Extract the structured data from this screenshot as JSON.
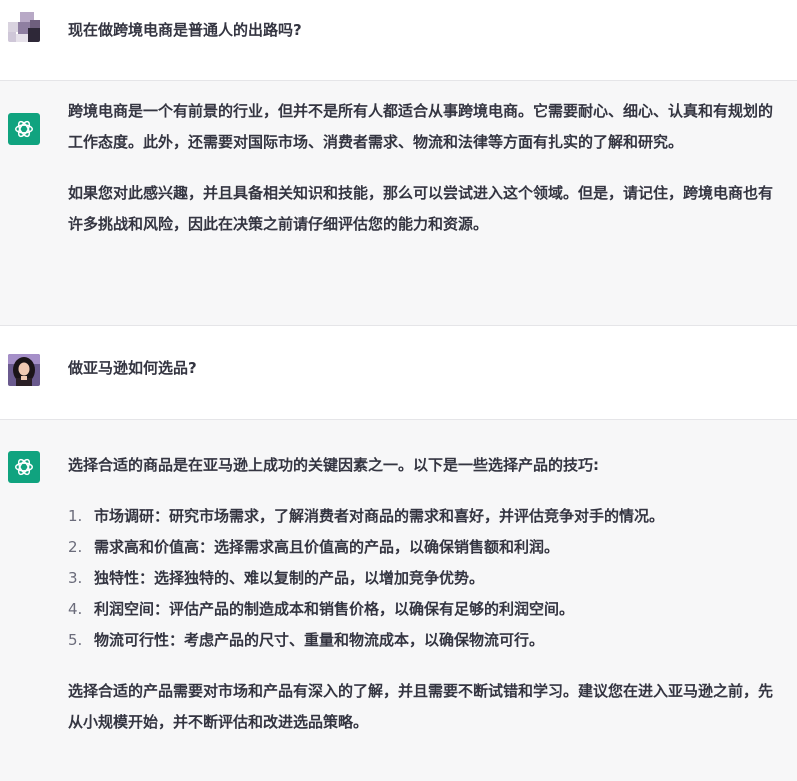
{
  "conversation": {
    "q1": "现在做跨境电商是普通人的出路吗?",
    "a1_p1": "跨境电商是一个有前景的行业，但并不是所有人都适合从事跨境电商。它需要耐心、细心、认真和有规划的工作态度。此外，还需要对国际市场、消费者需求、物流和法律等方面有扎实的了解和研究。",
    "a1_p2": "如果您对此感兴趣，并且具备相关知识和技能，那么可以尝试进入这个领域。但是，请记住，跨境电商也有许多挑战和风险，因此在决策之前请仔细评估您的能力和资源。",
    "q2": "做亚马逊如何选品?",
    "a2_intro": "选择合适的商品是在亚马逊上成功的关键因素之一。以下是一些选择产品的技巧:",
    "a2_list": [
      {
        "num": "1.",
        "text": "市场调研：研究市场需求，了解消费者对商品的需求和喜好，并评估竞争对手的情况。"
      },
      {
        "num": "2.",
        "text": "需求高和价值高：选择需求高且价值高的产品，以确保销售额和利润。"
      },
      {
        "num": "3.",
        "text": "独特性：选择独特的、难以复制的产品，以增加竞争优势。"
      },
      {
        "num": "4.",
        "text": "利润空间：评估产品的制造成本和销售价格，以确保有足够的利润空间。"
      },
      {
        "num": "5.",
        "text": "物流可行性：考虑产品的尺寸、重量和物流成本，以确保物流可行。"
      }
    ],
    "a2_outro": "选择合适的产品需要对市场和产品有深入的了解，并且需要不断试错和学习。建议您在进入亚马逊之前，先从小规模开始，并不断评估和改进选品策略。"
  },
  "colors": {
    "bot_avatar_bg": "#10a37f",
    "bot_row_bg": "#f7f7f8",
    "text": "#343541"
  },
  "icons": {
    "bot_avatar": "openai-logo-icon",
    "user_avatar": "user-photo-avatar"
  }
}
